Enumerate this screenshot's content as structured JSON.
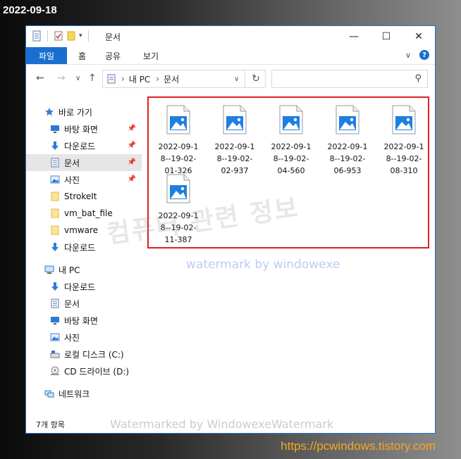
{
  "date_label": "2022-09-18",
  "site_link": "https://pcwindows.tistory.com",
  "window": {
    "title": "문서",
    "controls": [
      "—",
      "☐",
      "✕"
    ]
  },
  "ribbon": {
    "file_tab": "파일",
    "tabs": [
      "홈",
      "공유",
      "보기"
    ]
  },
  "address": {
    "crumbs": [
      "내 PC",
      "문서"
    ]
  },
  "sidebar": {
    "items": [
      {
        "label": "바로 가기",
        "icon": "star-icon"
      },
      {
        "label": "바탕 화면",
        "icon": "desktop-icon",
        "pinned": true
      },
      {
        "label": "다운로드",
        "icon": "download-arrow-icon",
        "pinned": true
      },
      {
        "label": "문서",
        "icon": "document-icon",
        "pinned": true,
        "selected": true
      },
      {
        "label": "사진",
        "icon": "picture-icon",
        "pinned": true
      },
      {
        "label": "StrokeIt",
        "icon": "folder-icon"
      },
      {
        "label": "vm_bat_file",
        "icon": "folder-icon"
      },
      {
        "label": "vmware",
        "icon": "folder-icon"
      },
      {
        "label": "다운로드",
        "icon": "download-arrow-icon"
      },
      {
        "label": "내 PC",
        "icon": "computer-icon"
      },
      {
        "label": "다운로드",
        "icon": "download-arrow-icon"
      },
      {
        "label": "문서",
        "icon": "document-icon"
      },
      {
        "label": "바탕 화면",
        "icon": "desktop-icon"
      },
      {
        "label": "사진",
        "icon": "picture-icon"
      },
      {
        "label": "로컬 디스크 (C:)",
        "icon": "drive-icon"
      },
      {
        "label": "CD 드라이브 (D:)",
        "icon": "cd-drive-icon"
      },
      {
        "label": "네트워크",
        "icon": "network-icon"
      }
    ]
  },
  "files": [
    {
      "line1": "2022-09-1",
      "line2": "8--19-02-",
      "line3": "01-326"
    },
    {
      "line1": "2022-09-1",
      "line2": "8--19-02-",
      "line3": "02-937"
    },
    {
      "line1": "2022-09-1",
      "line2": "8--19-02-",
      "line3": "04-560"
    },
    {
      "line1": "2022-09-1",
      "line2": "8--19-02-",
      "line3": "06-953"
    },
    {
      "line1": "2022-09-1",
      "line2": "8--19-02-",
      "line3": "08-310"
    },
    {
      "line1": "2022-09-1",
      "line2": "8--19-02-",
      "line3": "11-387"
    }
  ],
  "status": {
    "count": "7개 항목"
  },
  "watermarks": {
    "korean": "컴퓨터 관련 정보",
    "blue": "watermark by windowexe",
    "bottom": "Watermarked by WindowexeWatermark"
  },
  "colors": {
    "accent": "#1a6ed0",
    "highlight_border": "#e02020",
    "link": "#f5a623"
  }
}
